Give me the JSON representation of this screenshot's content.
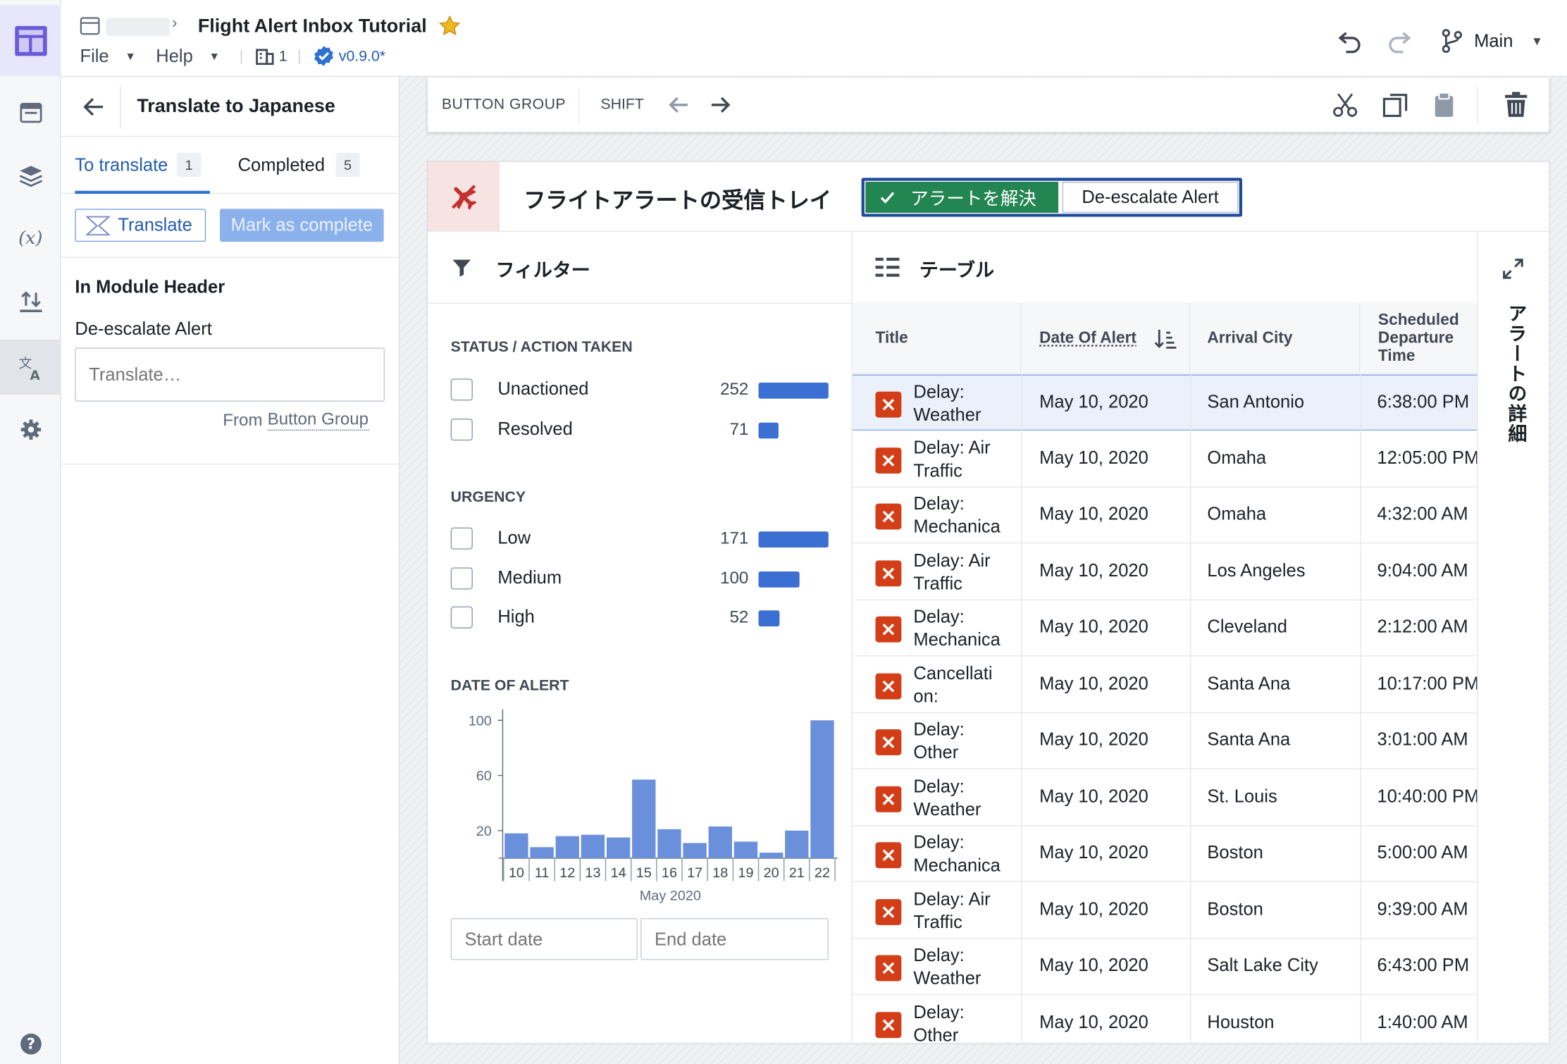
{
  "header": {
    "title": "Flight Alert Inbox Tutorial",
    "menus": [
      "File",
      "Help"
    ],
    "page_count": "1",
    "version": "v0.9.0*",
    "branch": "Main"
  },
  "left_panel": {
    "title": "Translate to Japanese",
    "tabs": [
      {
        "label": "To translate",
        "count": "1"
      },
      {
        "label": "Completed",
        "count": "5"
      }
    ],
    "translate_button": "Translate",
    "mark_complete_button": "Mark as complete",
    "section_title": "In Module Header",
    "field_label": "De-escalate Alert",
    "input_placeholder": "Translate…",
    "source_prefix": "From",
    "source_link": "Button Group"
  },
  "toolbar": {
    "breadcrumb": "BUTTON GROUP",
    "shift_label": "SHIFT"
  },
  "module": {
    "title": "フライトアラートの受信トレイ",
    "resolve_button": "アラートを解決",
    "deescalate_button": "De-escalate Alert",
    "side_panel_label": "アラートの詳細"
  },
  "filters": {
    "title": "フィルター",
    "status": {
      "label": "STATUS / ACTION TAKEN",
      "items": [
        {
          "label": "Unactioned",
          "count": "252",
          "fraction": 1.0
        },
        {
          "label": "Resolved",
          "count": "71",
          "fraction": 0.28
        }
      ]
    },
    "urgency": {
      "label": "URGENCY",
      "items": [
        {
          "label": "Low",
          "count": "171",
          "fraction": 1.0
        },
        {
          "label": "Medium",
          "count": "100",
          "fraction": 0.58
        },
        {
          "label": "High",
          "count": "52",
          "fraction": 0.3
        }
      ]
    },
    "date_label": "DATE OF ALERT",
    "start_placeholder": "Start date",
    "end_placeholder": "End date"
  },
  "chart_data": {
    "type": "bar",
    "categories": [
      "10",
      "11",
      "12",
      "13",
      "14",
      "15",
      "16",
      "17",
      "18",
      "19",
      "20",
      "21",
      "22"
    ],
    "values": [
      18,
      8,
      16,
      17,
      15,
      57,
      21,
      11,
      23,
      12,
      4,
      20,
      100
    ],
    "xlabel": "May 2020",
    "yticks": [
      "100",
      "60",
      "20"
    ],
    "ytick_values": [
      100,
      60,
      20
    ],
    "ylim": [
      0,
      100
    ],
    "color": "#6a8fdb"
  },
  "table": {
    "title": "テーブル",
    "columns": [
      "Title",
      "Date Of Alert",
      "Arrival City",
      "Scheduled Departure Time"
    ],
    "rows": [
      {
        "title": "Delay: Weather",
        "date": "May 10, 2020",
        "city": "San Antonio",
        "time": "6:38:00 PM"
      },
      {
        "title": "Delay: Air Traffic",
        "date": "May 10, 2020",
        "city": "Omaha",
        "time": "12:05:00 PM"
      },
      {
        "title": "Delay: Mechanica",
        "date": "May 10, 2020",
        "city": "Omaha",
        "time": "4:32:00 AM"
      },
      {
        "title": "Delay: Air Traffic",
        "date": "May 10, 2020",
        "city": "Los Angeles",
        "time": "9:04:00 AM"
      },
      {
        "title": "Delay: Mechanica",
        "date": "May 10, 2020",
        "city": "Cleveland",
        "time": "2:12:00 AM"
      },
      {
        "title": "Cancellati on:",
        "date": "May 10, 2020",
        "city": "Santa Ana",
        "time": "10:17:00 PM"
      },
      {
        "title": "Delay: Other",
        "date": "May 10, 2020",
        "city": "Santa Ana",
        "time": "3:01:00 AM"
      },
      {
        "title": "Delay: Weather",
        "date": "May 10, 2020",
        "city": "St. Louis",
        "time": "10:40:00 PM"
      },
      {
        "title": "Delay: Mechanica",
        "date": "May 10, 2020",
        "city": "Boston",
        "time": "5:00:00 AM"
      },
      {
        "title": "Delay: Air Traffic",
        "date": "May 10, 2020",
        "city": "Boston",
        "time": "9:39:00 AM"
      },
      {
        "title": "Delay: Weather",
        "date": "May 10, 2020",
        "city": "Salt Lake City",
        "time": "6:43:00 PM"
      },
      {
        "title": "Delay: Other",
        "date": "May 10, 2020",
        "city": "Houston",
        "time": "1:40:00 AM"
      }
    ]
  },
  "icons": [
    "app-logo-icon",
    "page-icon",
    "layers-icon",
    "variable-icon",
    "import-export-icon",
    "translate-icon",
    "gear-icon",
    "help-icon",
    "folder-icon",
    "star-icon",
    "building-icon",
    "verified-icon",
    "undo-icon",
    "redo-icon",
    "branch-icon",
    "back-arrow-icon",
    "translate-small-icon",
    "arrow-left-icon",
    "arrow-right-icon",
    "cut-icon",
    "copy-icon",
    "paste-icon",
    "trash-icon",
    "airplane-cancel-icon",
    "check-icon",
    "filter-icon",
    "table-icon",
    "sort-icon",
    "expand-icon"
  ]
}
